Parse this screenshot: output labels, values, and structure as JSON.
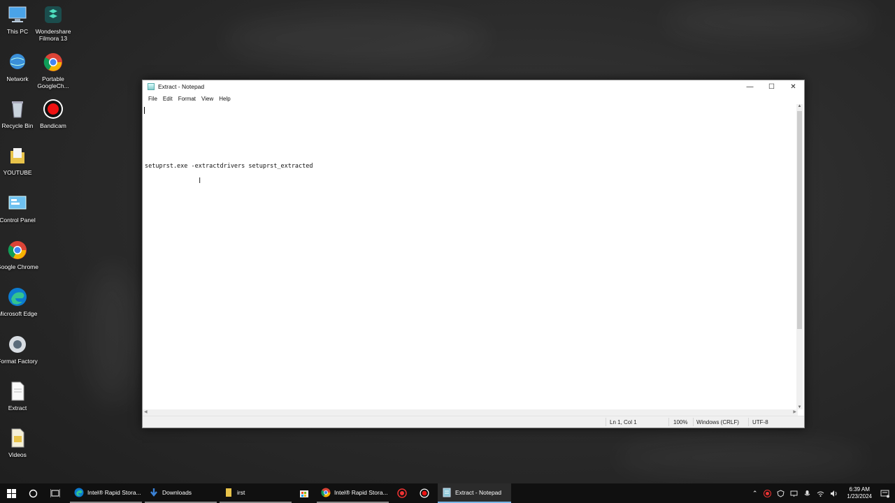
{
  "desktop": {
    "icons": [
      {
        "label": "This PC"
      },
      {
        "label": "Wondershare Filmora 13"
      },
      {
        "label": "Network"
      },
      {
        "label": "Portable GoogleCh..."
      },
      {
        "label": "Recycle Bin"
      },
      {
        "label": "Bandicam"
      },
      {
        "label": "YOUTUBE"
      },
      {
        "label": "Control Panel"
      },
      {
        "label": "Google Chrome"
      },
      {
        "label": "Microsoft Edge"
      },
      {
        "label": "Format Factory"
      },
      {
        "label": "Extract"
      },
      {
        "label": "Videos"
      }
    ]
  },
  "window": {
    "title": "Extract - Notepad",
    "controls": {
      "minimize": "—",
      "maximize": "☐",
      "close": "✕"
    },
    "menu": [
      "File",
      "Edit",
      "Format",
      "View",
      "Help"
    ],
    "content": "setuprst.exe -extractdrivers setuprst_extracted",
    "status": {
      "position": "Ln 1, Col 1",
      "zoom": "100%",
      "line_endings": "Windows (CRLF)",
      "encoding": "UTF-8"
    }
  },
  "taskbar": {
    "apps": [
      {
        "label": "Intel® Rapid Stora...",
        "color": "#1f8dd6"
      },
      {
        "label": "Downloads",
        "color": "#3b82d6"
      },
      {
        "label": "irst",
        "color": "#e8c34a"
      },
      {
        "label": "Intel® Rapid Stora...",
        "color": "#e94235"
      },
      {
        "label": "Extract - Notepad",
        "color": "#8fc8d8"
      }
    ],
    "clock": {
      "time": "6:39 AM",
      "date": "1/23/2024"
    }
  }
}
